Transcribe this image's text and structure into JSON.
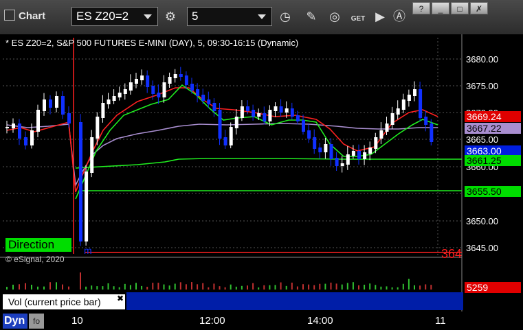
{
  "window": {
    "title": "Chart",
    "buttons": [
      "?",
      "□",
      "✗"
    ]
  },
  "toolbar": {
    "symbol": "ES Z20=2",
    "interval": "5"
  },
  "chart": {
    "info_line": "* ES Z20=2, S&P 500 FUTURES E-MINI (DAY), 5, 09:30-16:15 (Dynamic)",
    "price_labels": [
      "3680.00",
      "3675.00",
      "3670.00",
      "3665.00",
      "3660.00",
      "3650.00",
      "3645.00"
    ],
    "tags": [
      {
        "text": "3669.24",
        "bg": "#e00000",
        "fg": "#ffffff"
      },
      {
        "text": "3667.22",
        "bg": "#a98ed0",
        "fg": "#000000"
      },
      {
        "text": "3663.00",
        "bg": "#001ee0",
        "fg": "#ffffff"
      },
      {
        "text": "3661.25",
        "bg": "#00dd00",
        "fg": "#000000"
      },
      {
        "text": "3655.50",
        "bg": "#00dd00",
        "fg": "#000000"
      }
    ],
    "red_right_text": "364",
    "direction_label": "Direction",
    "copyright": "© eSignal, 2020",
    "time_labels": [
      "10",
      "12:00",
      "14:00",
      "11"
    ]
  },
  "volume": {
    "label": "Vol (current price bar)",
    "close": "✖",
    "value": "5259",
    "value_bg": "#e00000"
  },
  "status": {
    "dyn": "Dyn"
  },
  "colors": {
    "background": "#000000",
    "up": "#ffffff",
    "down": "#1030ff",
    "ma_red": "#ff2020",
    "ma_green": "#20ee20",
    "ma_purple": "#a98ed0"
  }
}
